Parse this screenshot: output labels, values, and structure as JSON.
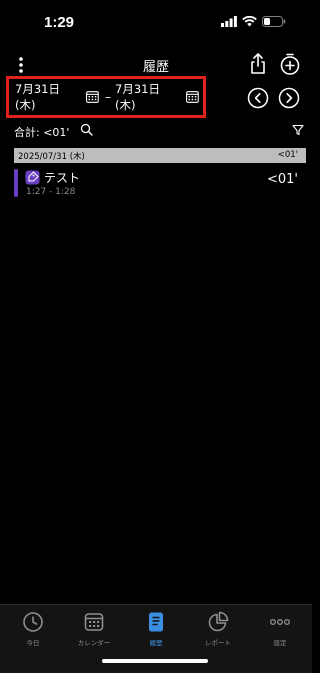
{
  "status_bar": {
    "time": "1:29"
  },
  "nav": {
    "title": "履歴"
  },
  "date_range": {
    "start": "7月31日 (木)",
    "separator": "–",
    "end": "7月31日 (木)"
  },
  "summary": {
    "total": "合計: <01'"
  },
  "day_group": {
    "date": "2025/07/31 (木)",
    "total": "<01'"
  },
  "entries": [
    {
      "name": "テスト",
      "time": "1:27 - 1:28",
      "duration": "<01'",
      "color": "#6b3fc3"
    }
  ],
  "tabs": [
    {
      "label": "今日",
      "icon": "clock-icon",
      "active": false
    },
    {
      "label": "カレンダー",
      "icon": "calendar-icon",
      "active": false
    },
    {
      "label": "履歴",
      "icon": "document-icon",
      "active": true
    },
    {
      "label": "レポート",
      "icon": "pie-chart-icon",
      "active": false
    },
    {
      "label": "設定",
      "icon": "more-dots-icon",
      "active": false
    }
  ],
  "colors": {
    "accent": "#3b8fe0",
    "highlight_border": "#e2201c",
    "header_bg": "#bdbdbd"
  }
}
